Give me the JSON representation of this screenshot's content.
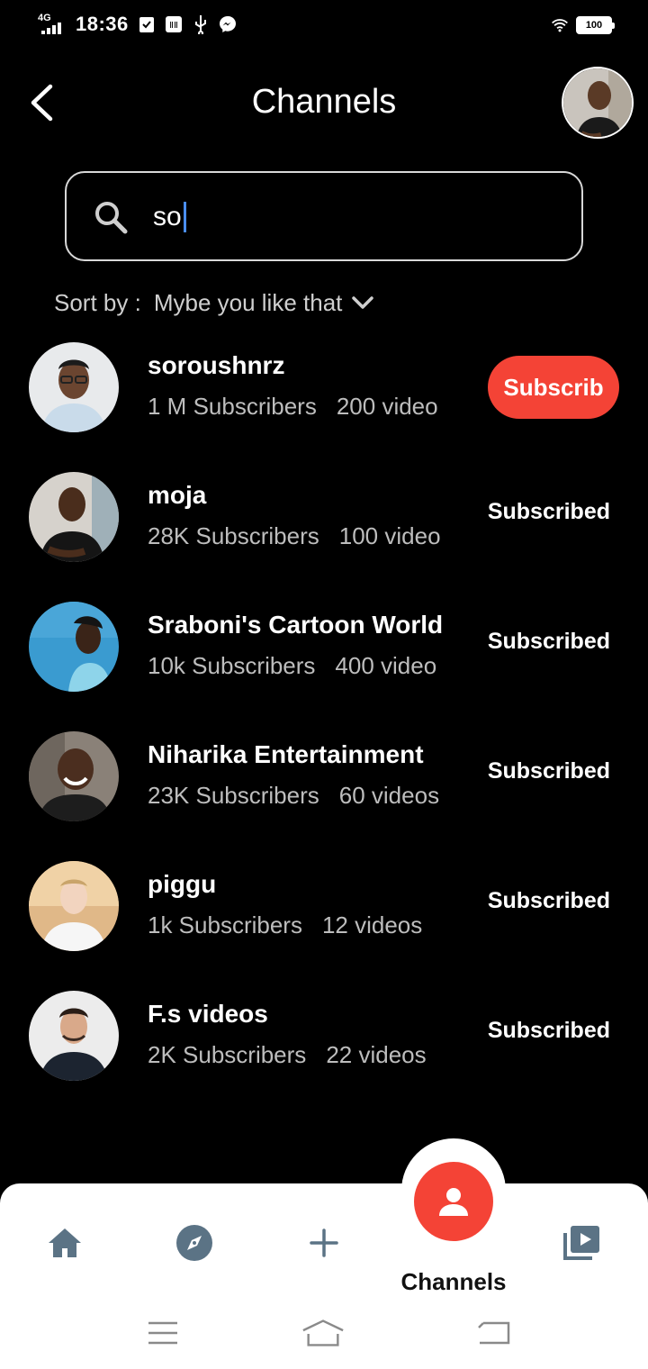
{
  "status_bar": {
    "network": "4G",
    "time": "18:36",
    "battery": "100"
  },
  "header": {
    "title": "Channels"
  },
  "search": {
    "value": "so"
  },
  "sort": {
    "label": "Sort by :",
    "value": "Mybe you like that"
  },
  "channels": [
    {
      "name": "soroushnrz",
      "subscribers": "1 M Subscribers",
      "videos": "200 video",
      "action": "Subscrib",
      "subscribed": false
    },
    {
      "name": "moja",
      "subscribers": "28K Subscribers",
      "videos": "100 video",
      "action": "Subscribed",
      "subscribed": true
    },
    {
      "name": "Sraboni's Cartoon World",
      "subscribers": "10k Subscribers",
      "videos": "400 video",
      "action": "Subscribed",
      "subscribed": true
    },
    {
      "name": "Niharika Entertainment",
      "subscribers": "23K Subscribers",
      "videos": "60 videos",
      "action": "Subscribed",
      "subscribed": true
    },
    {
      "name": "piggu",
      "subscribers": "1k Subscribers",
      "videos": "12 videos",
      "action": "Subscribed",
      "subscribed": true
    },
    {
      "name": "F.s videos",
      "subscribers": "2K Subscribers",
      "videos": "22 videos",
      "action": "Subscribed",
      "subscribed": true
    }
  ],
  "bottom_nav": {
    "active_label": "Channels",
    "icons": [
      "home-icon",
      "explore-icon",
      "add-icon",
      "person-icon",
      "video-library-icon"
    ]
  },
  "colors": {
    "accent": "#f44336",
    "nav_icon": "#5b7385",
    "background": "#000000"
  }
}
